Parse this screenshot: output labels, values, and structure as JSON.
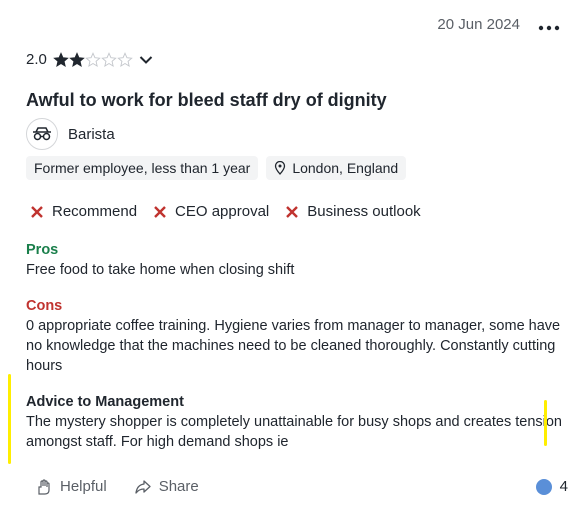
{
  "header": {
    "date": "20 Jun 2024",
    "more_icon": "more-horizontal-icon"
  },
  "rating": {
    "value": "2.0",
    "stars_filled": 2,
    "stars_total": 5
  },
  "title": "Awful to work for bleed staff dry of dignity",
  "role": {
    "icon": "barista-glasses-icon",
    "label": "Barista"
  },
  "tags": {
    "employment": "Former employee, less than 1 year",
    "location": "London, England"
  },
  "checks": [
    {
      "label": "Recommend",
      "status": "negative"
    },
    {
      "label": "CEO approval",
      "status": "negative"
    },
    {
      "label": "Business outlook",
      "status": "negative"
    }
  ],
  "pros": {
    "heading": "Pros",
    "text": "Free food to take home when closing shift"
  },
  "cons": {
    "heading": "Cons",
    "text": "0 appropriate coffee training. Hygiene varies from manager to manager, some have no knowledge that the machines need to be cleaned thoroughly. Constantly cutting hours"
  },
  "advice": {
    "heading": "Advice to Management",
    "text": "The mystery shopper is completely unattainable for busy shops and creates tension amongst staff. For high demand shops ie"
  },
  "footer": {
    "helpful_label": "Helpful",
    "share_label": "Share",
    "reaction_count": "4"
  },
  "colors": {
    "pros": "#1a7f4b",
    "cons": "#c0332f",
    "negative_x": "#c0332f",
    "highlight": "#ffee00"
  }
}
